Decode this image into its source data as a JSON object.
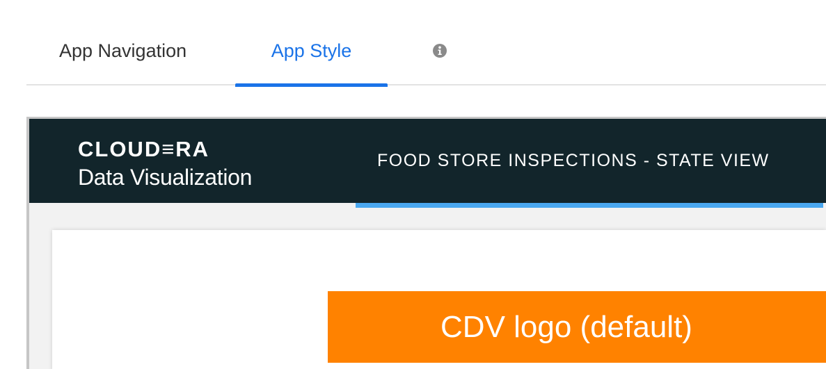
{
  "tabs": {
    "items": [
      {
        "label": "App Navigation"
      },
      {
        "label": "App Style"
      }
    ],
    "active_color": "#1a73e8",
    "info_icon": "info-circle-icon"
  },
  "preview": {
    "brand_name": "CLOUD≡RA",
    "brand_sub": "Data Visualization",
    "nav_item": "FOOD STORE INSPECTIONS - STATE VIEW",
    "header_color": "#12252b",
    "underline_color": "#4aa8f0",
    "logo_banner": {
      "label": "CDV logo (default)",
      "color": "#ff8200"
    }
  }
}
